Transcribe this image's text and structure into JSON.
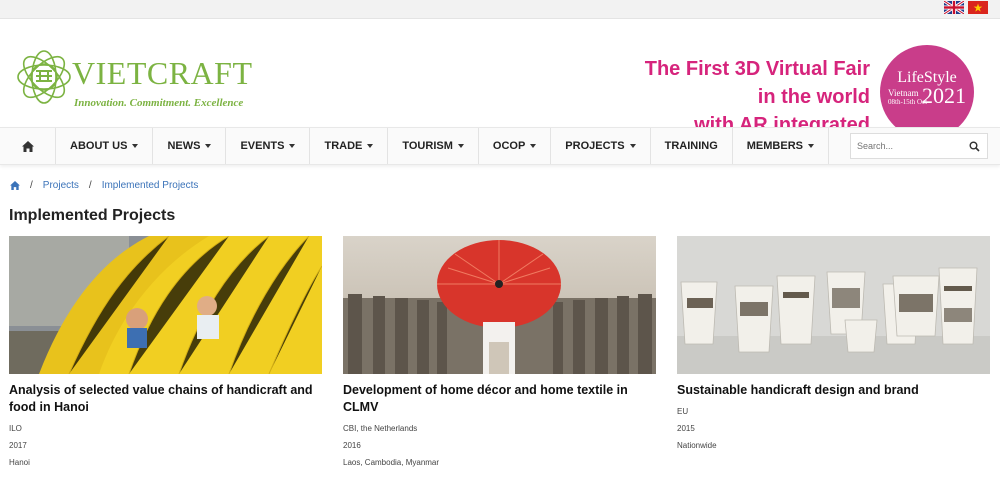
{
  "header": {
    "logo_name": "VIETCRAFT",
    "logo_tagline": "Innovation. Commitment. Excellence",
    "promo_lines": [
      "The First 3D Virtual Fair",
      "in the world",
      "with AR integrated"
    ],
    "badge": {
      "line1": "LifeStyle",
      "line2": "Vietnam",
      "line3": "08th-15th Oct",
      "year": "2021"
    }
  },
  "nav": {
    "items": [
      {
        "label": "ABOUT US",
        "dropdown": true
      },
      {
        "label": "NEWS",
        "dropdown": true
      },
      {
        "label": "EVENTS",
        "dropdown": true
      },
      {
        "label": "TRADE",
        "dropdown": true
      },
      {
        "label": "TOURISM",
        "dropdown": true
      },
      {
        "label": "OCOP",
        "dropdown": true
      },
      {
        "label": "PROJECTS",
        "dropdown": true
      },
      {
        "label": "TRAINING",
        "dropdown": false
      },
      {
        "label": "MEMBERS",
        "dropdown": true
      }
    ],
    "search_placeholder": "Search..."
  },
  "breadcrumb": {
    "items": [
      "Projects",
      "Implemented Projects"
    ]
  },
  "page": {
    "title": "Implemented Projects"
  },
  "projects": [
    {
      "title": "Analysis of selected value chains of handicraft and food in Hanoi",
      "sponsor": "ILO",
      "year": "2017",
      "location": "Hanoi"
    },
    {
      "title": "Development of home décor and home textile in CLMV",
      "sponsor": "CBI, the Netherlands",
      "year": "2016",
      "location": "Laos, Cambodia, Myanmar"
    },
    {
      "title": "Sustainable handicraft design and brand",
      "sponsor": "EU",
      "year": "2015",
      "location": "Nationwide"
    }
  ],
  "colors": {
    "brand_green": "#7cb342",
    "promo_pink": "#d6247c",
    "badge_pink": "#c93d8a",
    "link_blue": "#3b73b9"
  }
}
